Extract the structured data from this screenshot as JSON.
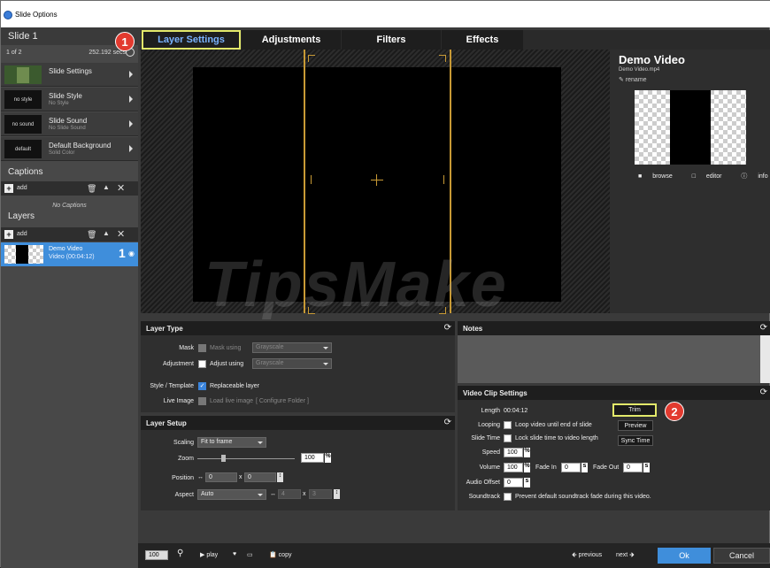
{
  "window": {
    "title": "Slide Options"
  },
  "left": {
    "slide_header": "Slide 1",
    "slide_count": "1 of 2",
    "slide_secs": "252.192 secs",
    "menu": [
      {
        "thumb": "",
        "title": "Slide Settings",
        "sub": ""
      },
      {
        "thumb": "no style",
        "title": "Slide Style",
        "sub": "No Style"
      },
      {
        "thumb": "no sound",
        "title": "Slide Sound",
        "sub": "No Slide Sound"
      },
      {
        "thumb": "default",
        "title": "Default Background",
        "sub": "Solid Color"
      }
    ],
    "captions_header": "Captions",
    "add_label": "add",
    "no_captions": "No Captions",
    "layers_header": "Layers",
    "layer": {
      "name": "Demo Video",
      "type": "Video (00:04:12)",
      "number": "1"
    }
  },
  "tabs": [
    "Layer Settings",
    "Adjustments",
    "Filters",
    "Effects"
  ],
  "info": {
    "title": "Demo Video",
    "file": "Demo Video.mp4",
    "rename": "rename",
    "browse": "browse",
    "editor": "editor",
    "info": "info"
  },
  "layer_type": {
    "header": "Layer Type",
    "mask_label": "Mask",
    "mask_using": "Mask using",
    "mask_select": "Grayscale",
    "adjustment_label": "Adjustment",
    "adjust_using": "Adjust using",
    "adjust_select": "Grayscale",
    "style_label": "Style / Template",
    "replaceable": "Replaceable layer",
    "live_label": "Live Image",
    "load_live": "Load live image",
    "configure": "[ Configure Folder ]"
  },
  "layer_setup": {
    "header": "Layer Setup",
    "scaling_label": "Scaling",
    "scaling_value": "Fit to frame",
    "zoom_label": "Zoom",
    "zoom_value": "100",
    "zoom_unit": "%",
    "position_label": "Position",
    "pos_x": "0",
    "pos_y": "0",
    "x_sep": "x",
    "aspect_label": "Aspect",
    "aspect_value": "Auto",
    "aspect_w": "4",
    "aspect_h": "3"
  },
  "notes": {
    "header": "Notes"
  },
  "video_clip": {
    "header": "Video Clip Settings",
    "length_label": "Length",
    "length_value": "00:04:12",
    "looping_label": "Looping",
    "looping_text": "Loop video until end of slide",
    "slidetime_label": "Slide Time",
    "slidetime_text": "Lock slide time to video length",
    "speed_label": "Speed",
    "speed_value": "100",
    "volume_label": "Volume",
    "volume_value": "100",
    "fadein_label": "Fade In",
    "fadein_value": "0",
    "fadeout_label": "Fade Out",
    "fadeout_value": "0",
    "audio_offset_label": "Audio Offset",
    "audio_offset_value": "0",
    "soundtrack_label": "Soundtrack",
    "soundtrack_text": "Prevent default soundtrack fade during this video.",
    "trim": "Trim",
    "preview": "Preview",
    "sync": "Sync Time",
    "pct": "%",
    "s": "s"
  },
  "badges": [
    "1",
    "2"
  ],
  "bottom": {
    "zoom": "100",
    "play": "play",
    "copy": "copy",
    "previous": "previous",
    "next": "next",
    "ok": "Ok",
    "cancel": "Cancel"
  },
  "watermark": "TipsMake",
  "colors": {
    "accent": "#3f8edb",
    "highlight": "#e3e96a",
    "badge": "#e23a2f",
    "guide": "#c89a35"
  }
}
